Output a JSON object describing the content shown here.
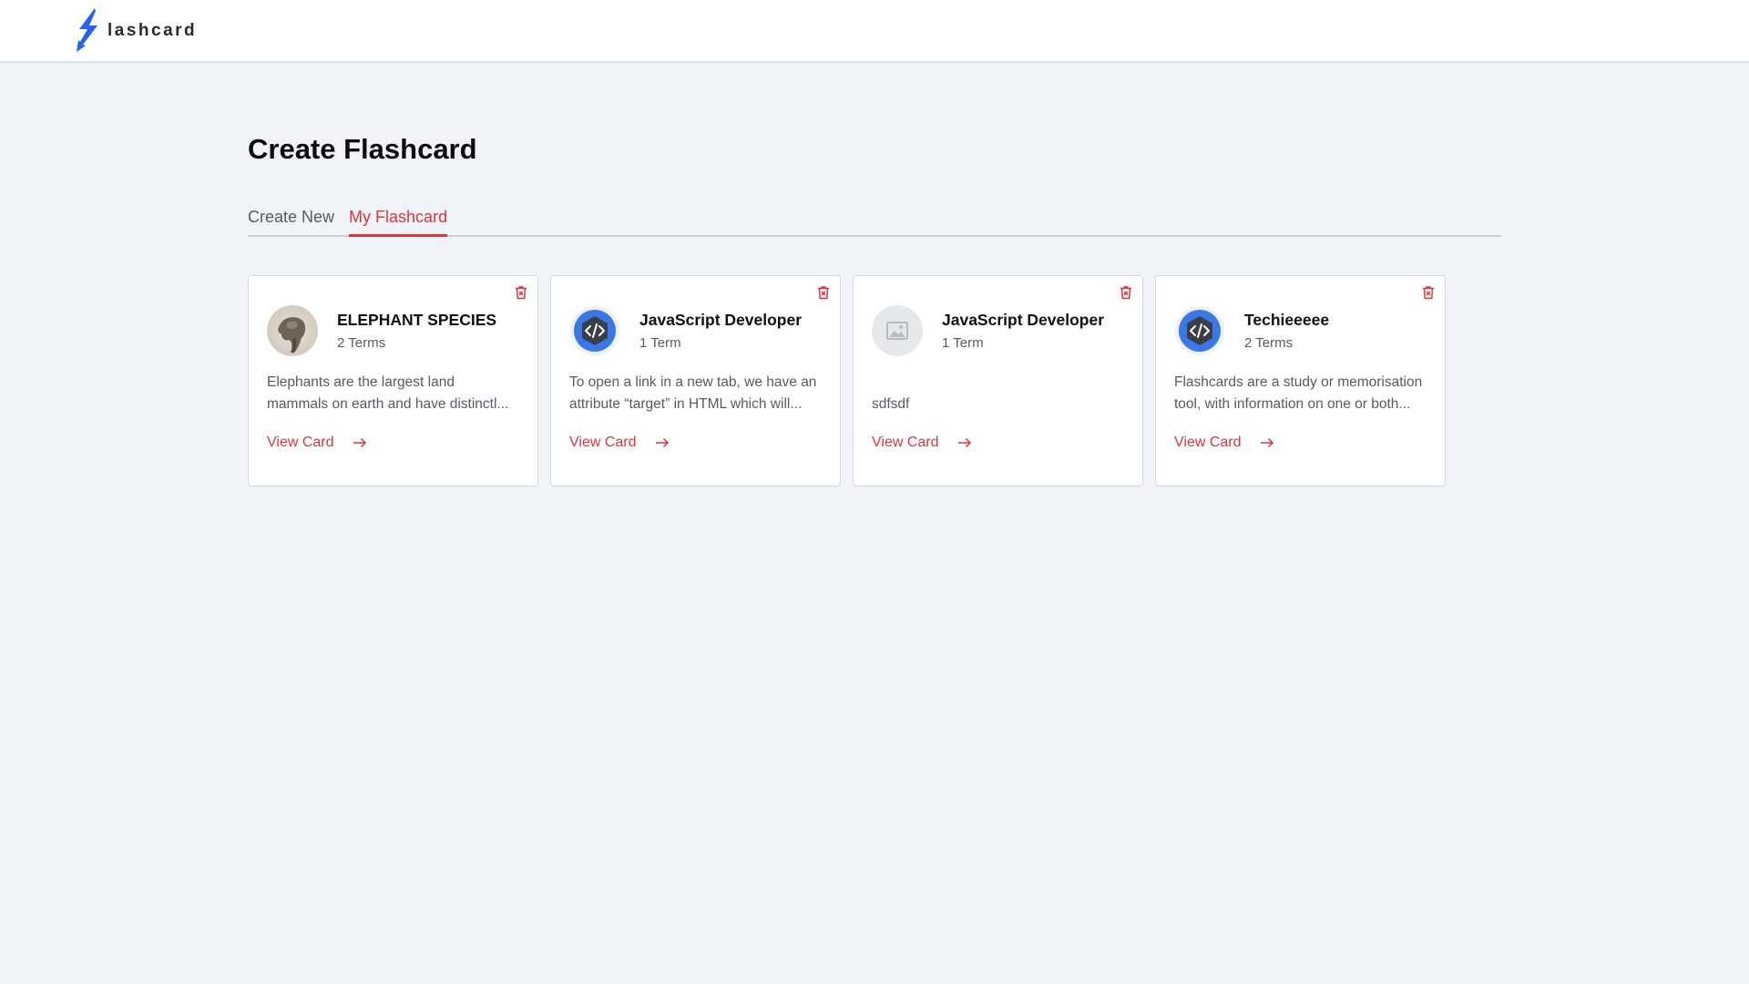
{
  "brand": {
    "name": "lashcard",
    "bolt_color": "#2563eb"
  },
  "page": {
    "title": "Create Flashcard"
  },
  "tabs": [
    {
      "label": "Create New",
      "active": false
    },
    {
      "label": "My Flashcard",
      "active": true
    }
  ],
  "accent": "#e0353a",
  "cards": [
    {
      "title": "ELEPHANT SPECIES",
      "terms": "2 Terms",
      "desc_line1": "Elephants are the largest land",
      "desc_line2": "mammals on earth and have distinctl...",
      "image": "elephant-photo",
      "view_label": "View Card"
    },
    {
      "title": "JavaScript Developer",
      "terms": "1 Term",
      "desc_line1": "To open a link in a new tab, we have an",
      "desc_line2": "attribute “target” in HTML which will...",
      "image": "code-icon",
      "view_label": "View Card"
    },
    {
      "title": "JavaScript Developer",
      "terms": "1 Term",
      "desc_line1": "",
      "desc_line2": "sdfsdf",
      "image": "image-placeholder-icon",
      "view_label": "View Card"
    },
    {
      "title": "Techieeeee",
      "terms": "2 Terms",
      "desc_line1": "Flashcards are a study or memorisation",
      "desc_line2": "tool, with information on one or both...",
      "image": "code-icon",
      "view_label": "View Card"
    }
  ]
}
